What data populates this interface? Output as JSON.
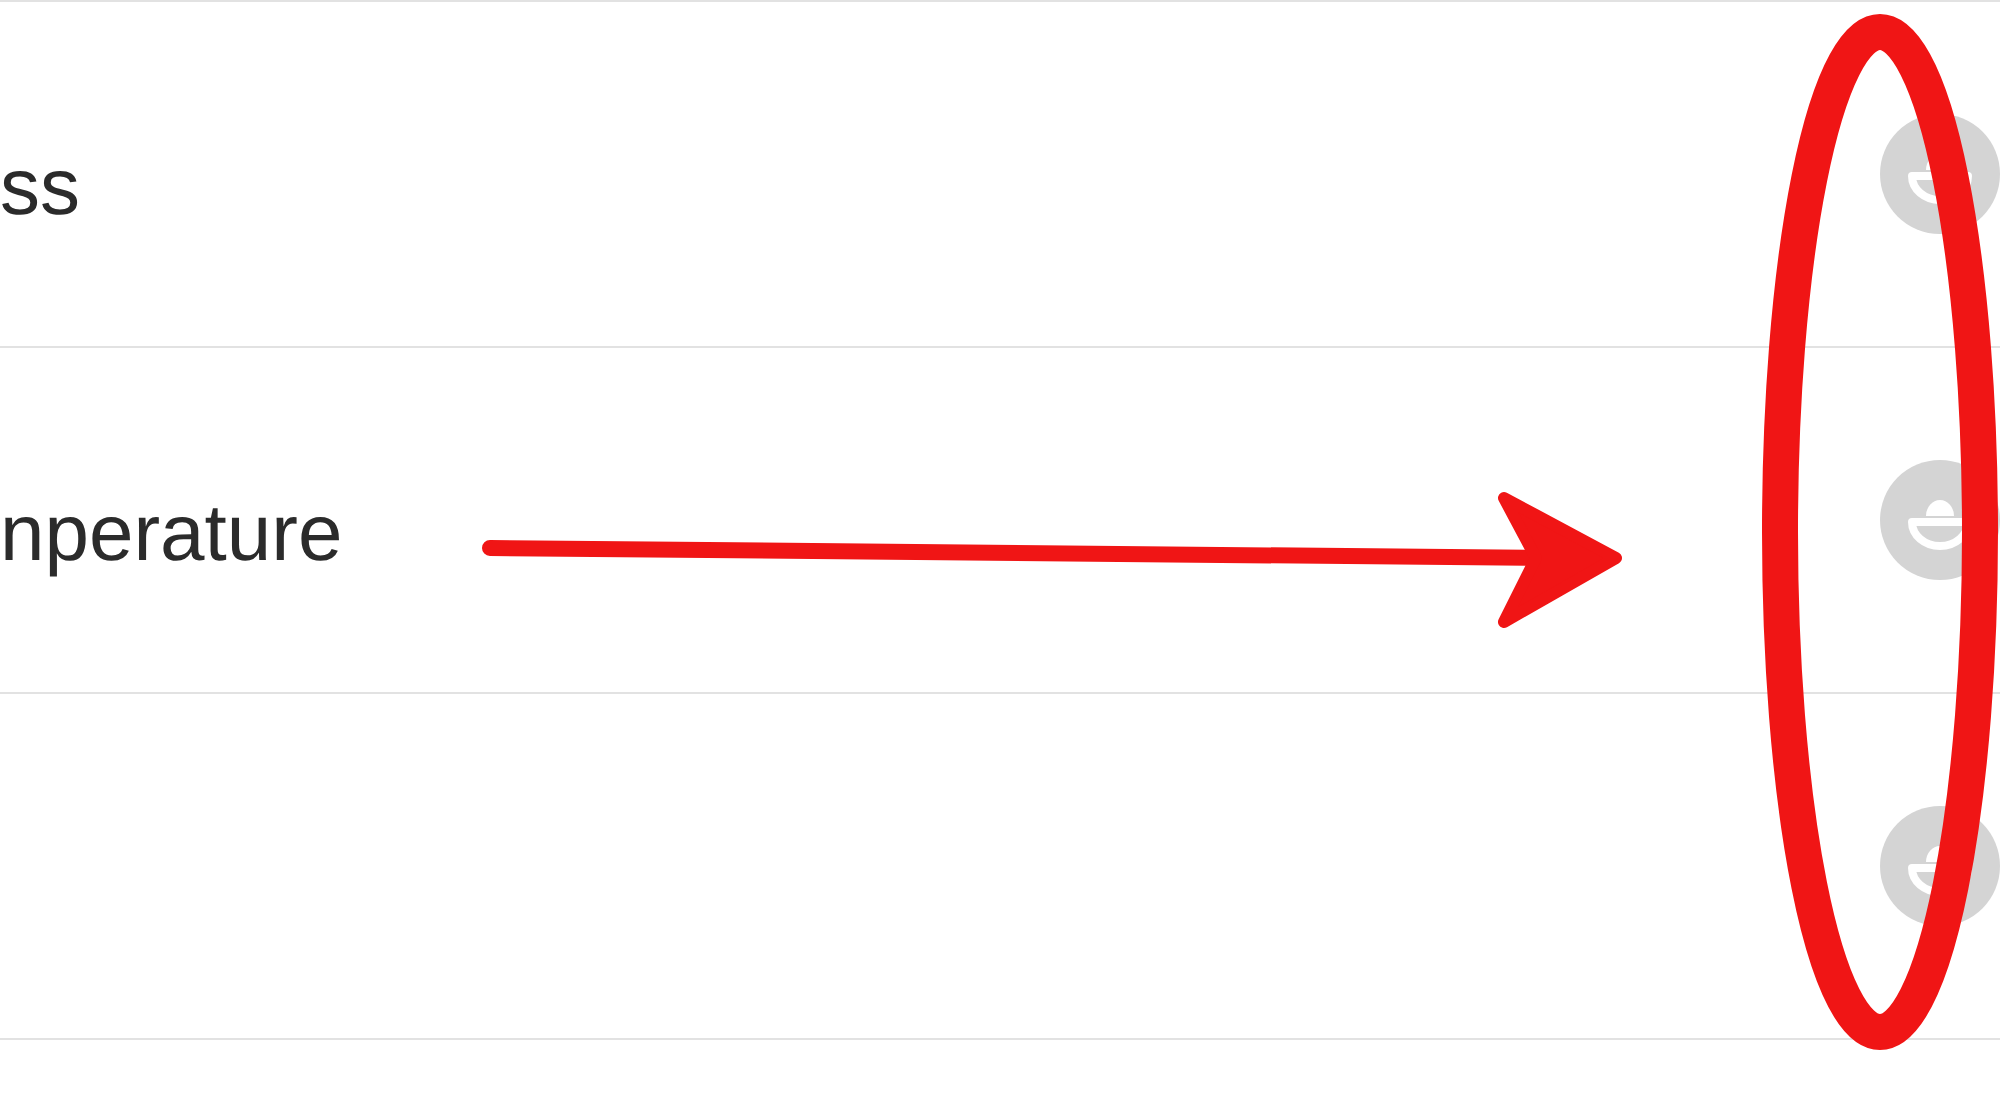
{
  "rows": [
    {
      "label": "ss"
    },
    {
      "label": "nperature"
    },
    {}
  ]
}
